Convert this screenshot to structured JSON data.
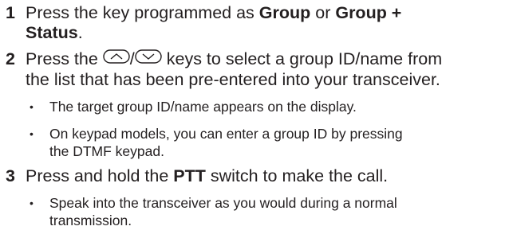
{
  "steps": [
    {
      "number": "1",
      "parts": {
        "a": "Press the key programmed as ",
        "b": "Group",
        "c": " or ",
        "d": "Group +",
        "e": "Status",
        "f": "."
      }
    },
    {
      "number": "2",
      "parts": {
        "a": "Press the ",
        "slash": "/",
        "b": " keys to select a group ID/name from",
        "c": "the list that has been pre-entered into your transceiver."
      },
      "icons": [
        "up-arrow-key-icon",
        "down-arrow-key-icon"
      ],
      "bullets": [
        "The target group ID/name appears on the display.",
        {
          "line1": "On keypad models, you can enter a group ID by pressing",
          "line2": "the DTMF keypad."
        }
      ]
    },
    {
      "number": "3",
      "parts": {
        "a": "Press and hold the ",
        "b": "PTT",
        "c": " switch to make the call."
      },
      "bullets": [
        {
          "line1": "Speak into the transceiver as you would during a normal",
          "line2": "transmission."
        }
      ]
    }
  ],
  "bullet_symbol": "•"
}
